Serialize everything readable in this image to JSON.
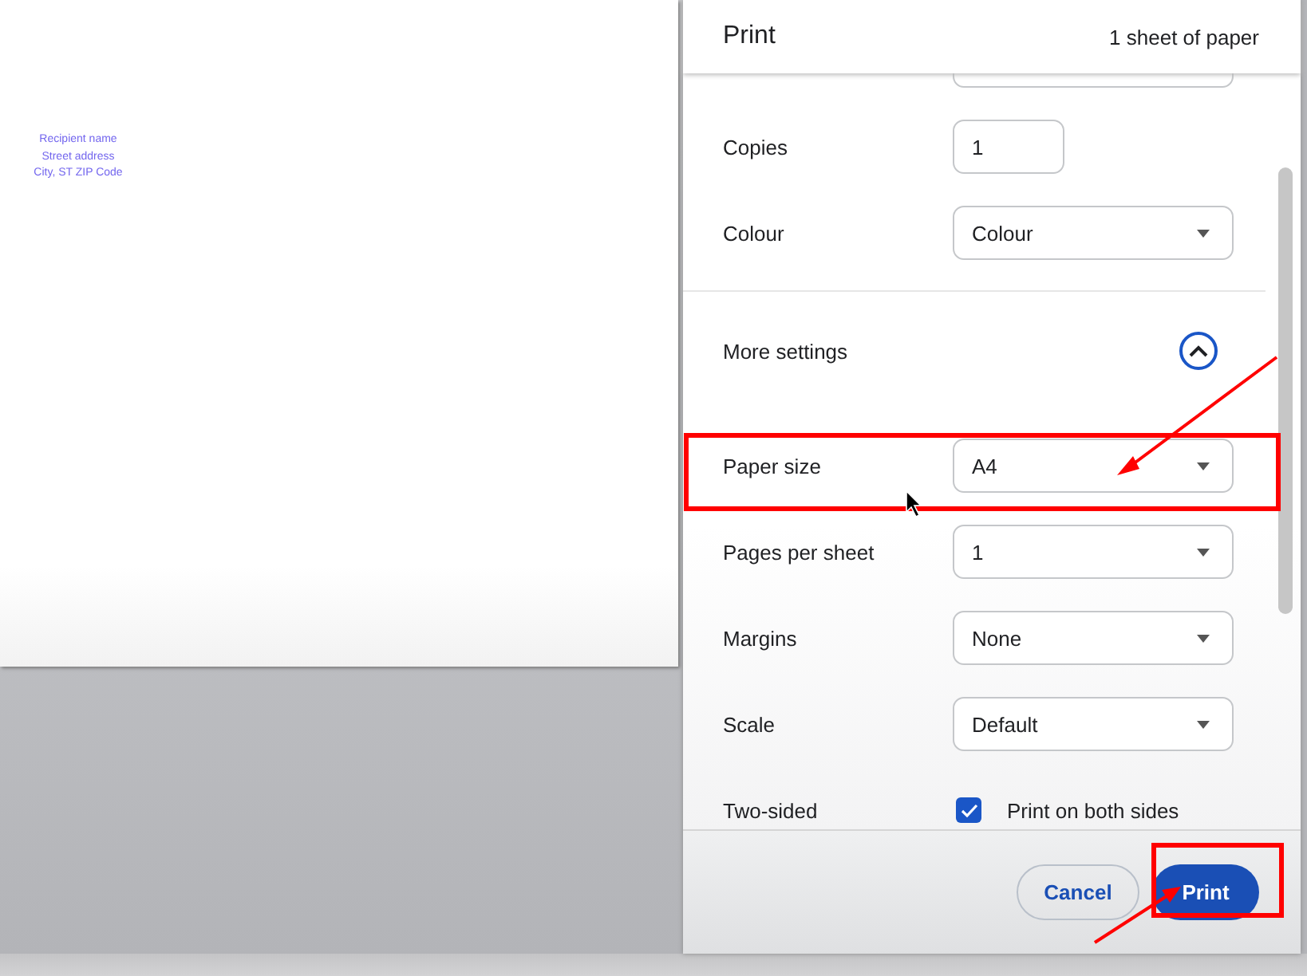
{
  "preview": {
    "address_lines": [
      "Recipient name",
      "Street address",
      "City, ST ZIP Code"
    ]
  },
  "dialog": {
    "title": "Print",
    "summary": "1 sheet of paper",
    "settings": [
      {
        "kind": "select"
      },
      {
        "kind": "input",
        "label": "Copies",
        "value": "1"
      },
      {
        "kind": "select",
        "label": "Colour",
        "value": "Colour"
      },
      {
        "kind": "expand",
        "label": "More settings",
        "expanded": true
      },
      {
        "kind": "select",
        "label": "Paper size",
        "value": "A4"
      },
      {
        "kind": "select",
        "label": "Pages per sheet",
        "value": "1"
      },
      {
        "kind": "select",
        "label": "Margins",
        "value": "None"
      },
      {
        "kind": "select",
        "label": "Scale",
        "value": "Default"
      },
      {
        "kind": "checkbox",
        "label": "Two-sided",
        "value": "Print on both sides",
        "checked": true
      }
    ],
    "buttons": [
      {
        "kind": "secondary",
        "label": "Cancel"
      },
      {
        "kind": "primary",
        "label": "Print"
      }
    ]
  }
}
